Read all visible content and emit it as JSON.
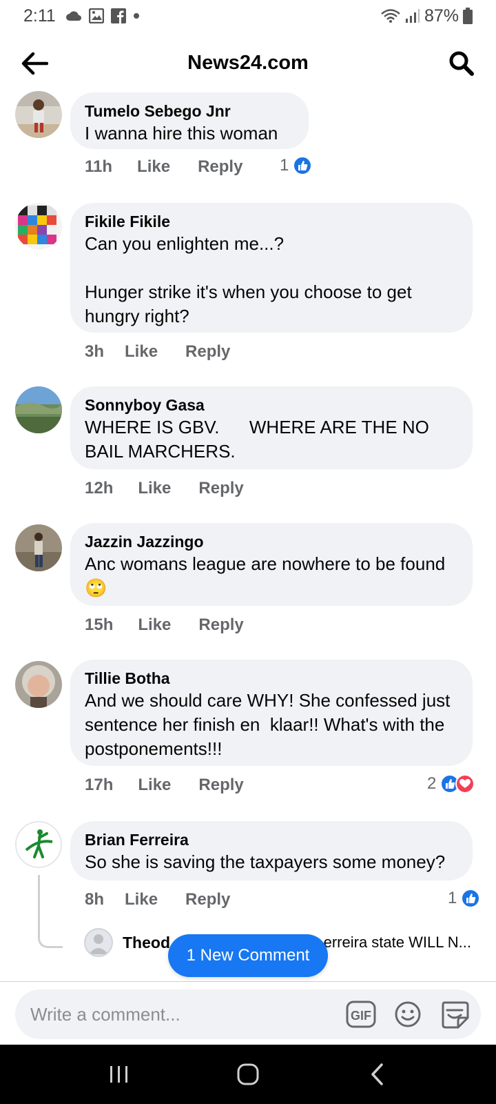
{
  "status_bar": {
    "time": "2:11",
    "battery": "87%",
    "icons": [
      "cloud-icon",
      "image-icon",
      "facebook-icon",
      "dot-icon",
      "wifi-icon",
      "signal-icon",
      "battery-icon"
    ]
  },
  "header": {
    "title": "News24.com",
    "back_icon": "back-arrow-icon",
    "search_icon": "search-icon"
  },
  "comments": [
    {
      "author": "Tumelo Sebego Jnr",
      "text": "I wanna hire this woman",
      "time": "11h",
      "like_label": "Like",
      "reply_label": "Reply",
      "reaction_count": "1",
      "reactions": [
        "like"
      ]
    },
    {
      "author": "Fikile Fikile",
      "text": "Can you enlighten me...?\n\nHunger strike it's when you choose to get hungry right?",
      "time": "3h",
      "like_label": "Like",
      "reply_label": "Reply"
    },
    {
      "author": "Sonnyboy Gasa",
      "text": "WHERE IS GBV.      WHERE ARE THE NO BAIL MARCHERS.",
      "time": "12h",
      "like_label": "Like",
      "reply_label": "Reply"
    },
    {
      "author": "Jazzin Jazzingo",
      "text": "Anc womans league are nowhere to be found 🙄",
      "time": "15h",
      "like_label": "Like",
      "reply_label": "Reply"
    },
    {
      "author": "Tillie Botha",
      "text": "And we should care WHY! She confessed just sentence her finish en  klaar!! What's with the postponements!!!",
      "time": "17h",
      "like_label": "Like",
      "reply_label": "Reply",
      "reaction_count": "2",
      "reactions": [
        "like",
        "love"
      ]
    },
    {
      "author": "Brian Ferreira",
      "text": "So she is saving the taxpayers some money?",
      "time": "8h",
      "like_label": "Like",
      "reply_label": "Reply",
      "reaction_count": "1",
      "reactions": [
        "like"
      ]
    }
  ],
  "reply_preview": {
    "author": "Theod",
    "text": "erreira state WILL N..."
  },
  "new_comment_pill": "1 New Comment",
  "composer": {
    "placeholder": "Write a comment...",
    "gif_label": "GIF"
  },
  "colors": {
    "accent": "#1877f2",
    "bubble": "#f0f2f5",
    "secondary_text": "#65676b",
    "love": "#f33e58"
  }
}
